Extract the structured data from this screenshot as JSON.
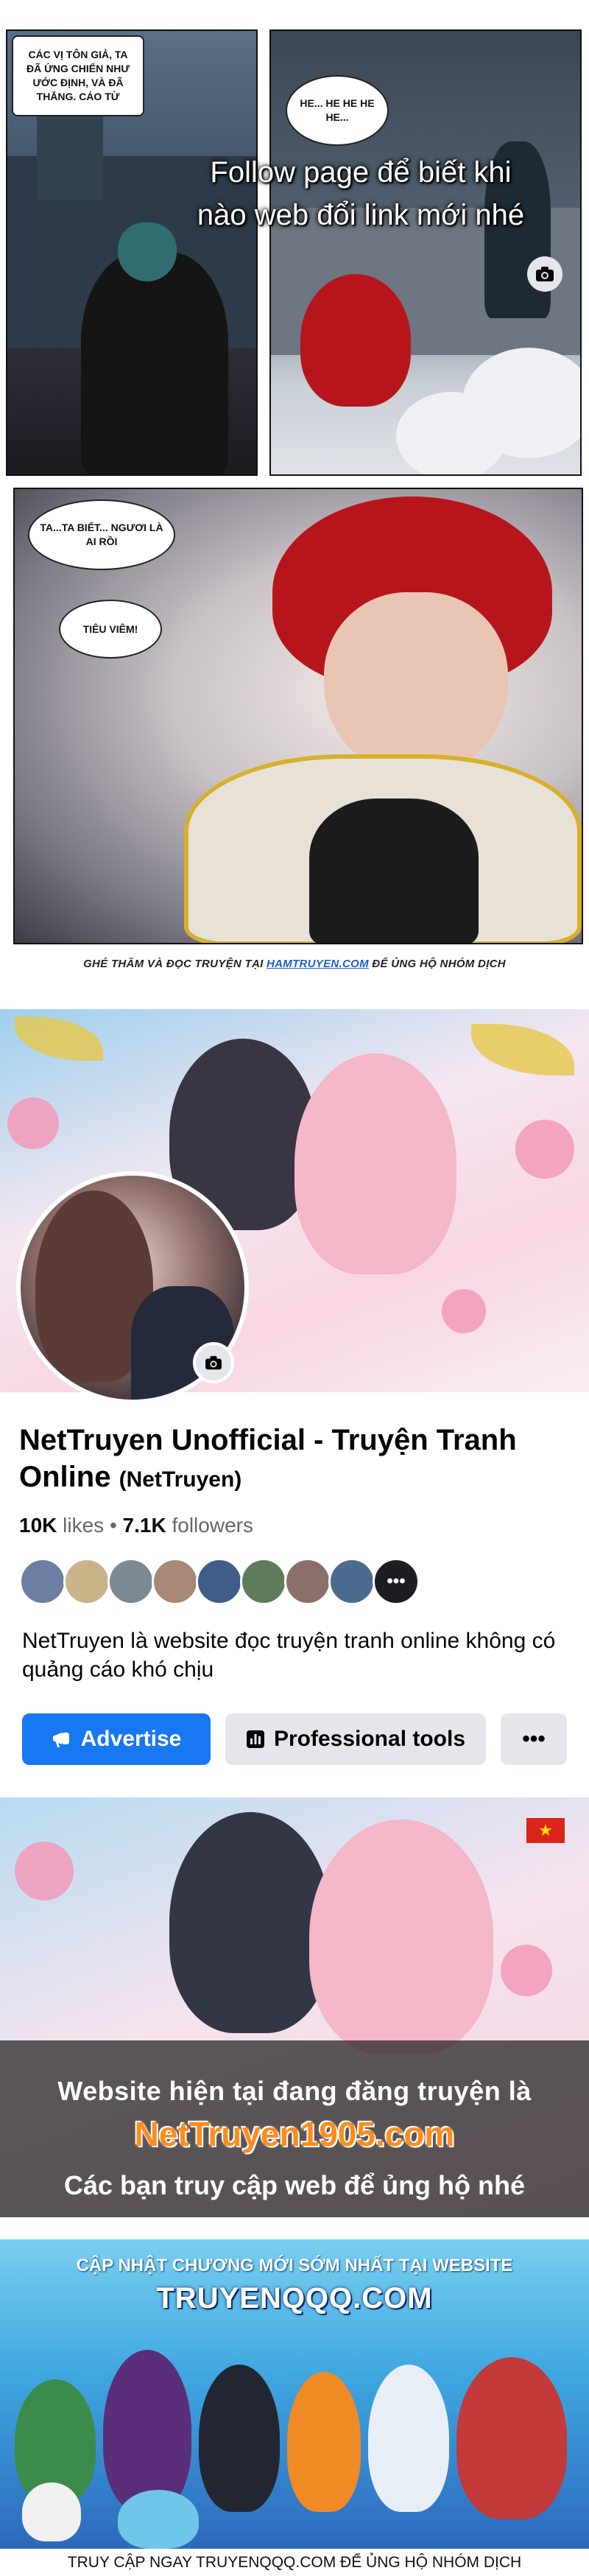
{
  "manga": {
    "panel1_bubble": "CÁC VỊ TÔN GIẢ, TA ĐÃ ỨNG CHIẾN NHƯ ƯỚC ĐỊNH, VÀ ĐÃ THẮNG.  CÁO TỪ",
    "panel2_bubble": "HE... HE HE HE HE...",
    "panel3_bubble_top": "TA...TA BIẾT... NGƯƠI LÀ AI RỒI",
    "panel3_bubble_bottom": "TIÊU VIÊM!",
    "credit_prefix": "GHÉ THĂM VÀ ĐỌC TRUYỆN TẠI ",
    "credit_site": "HAMTRUYEN.COM",
    "credit_suffix": " ĐỂ ỦNG HỘ NHÓM DỊCH"
  },
  "fb_page": {
    "cover_text_line1": "Follow page để biết khi",
    "cover_text_line2": "nào web đổi link mới nhé",
    "name": "NetTruyen Unofficial - Truyện Tranh Online",
    "handle": "(NetTruyen)",
    "likes_count": "10K",
    "likes_label": "likes",
    "followers_count": "7.1K",
    "followers_label": "followers",
    "more_friends": "•••",
    "description": "NetTruyen là website đọc truyện tranh online không có quảng cáo khó chịu",
    "advertise_label": "Advertise",
    "professional_tools_label": "Professional tools",
    "more_label": "•••",
    "colors": {
      "primary": "#1877f2",
      "secondary_btn": "#e4e6eb",
      "muted_text": "#65676b"
    }
  },
  "notice": {
    "line1": "Website hiện tại đang đăng truyện là",
    "site": "NetTruyen1905.com",
    "line2": "Các bạn truy cập web để ủng hộ nhé",
    "flag_star": "★"
  },
  "qqq_banner": {
    "headline": "CẬP NHẬT CHƯƠNG MỚI SỚM NHẤT TẠI WEBSITE",
    "logo": "TRUYENQQQ.COM",
    "footer": "TRUY CẬP NGAY TRUYENQQQ.COM ĐỂ ỦNG HỘ NHÓM DỊCH"
  }
}
